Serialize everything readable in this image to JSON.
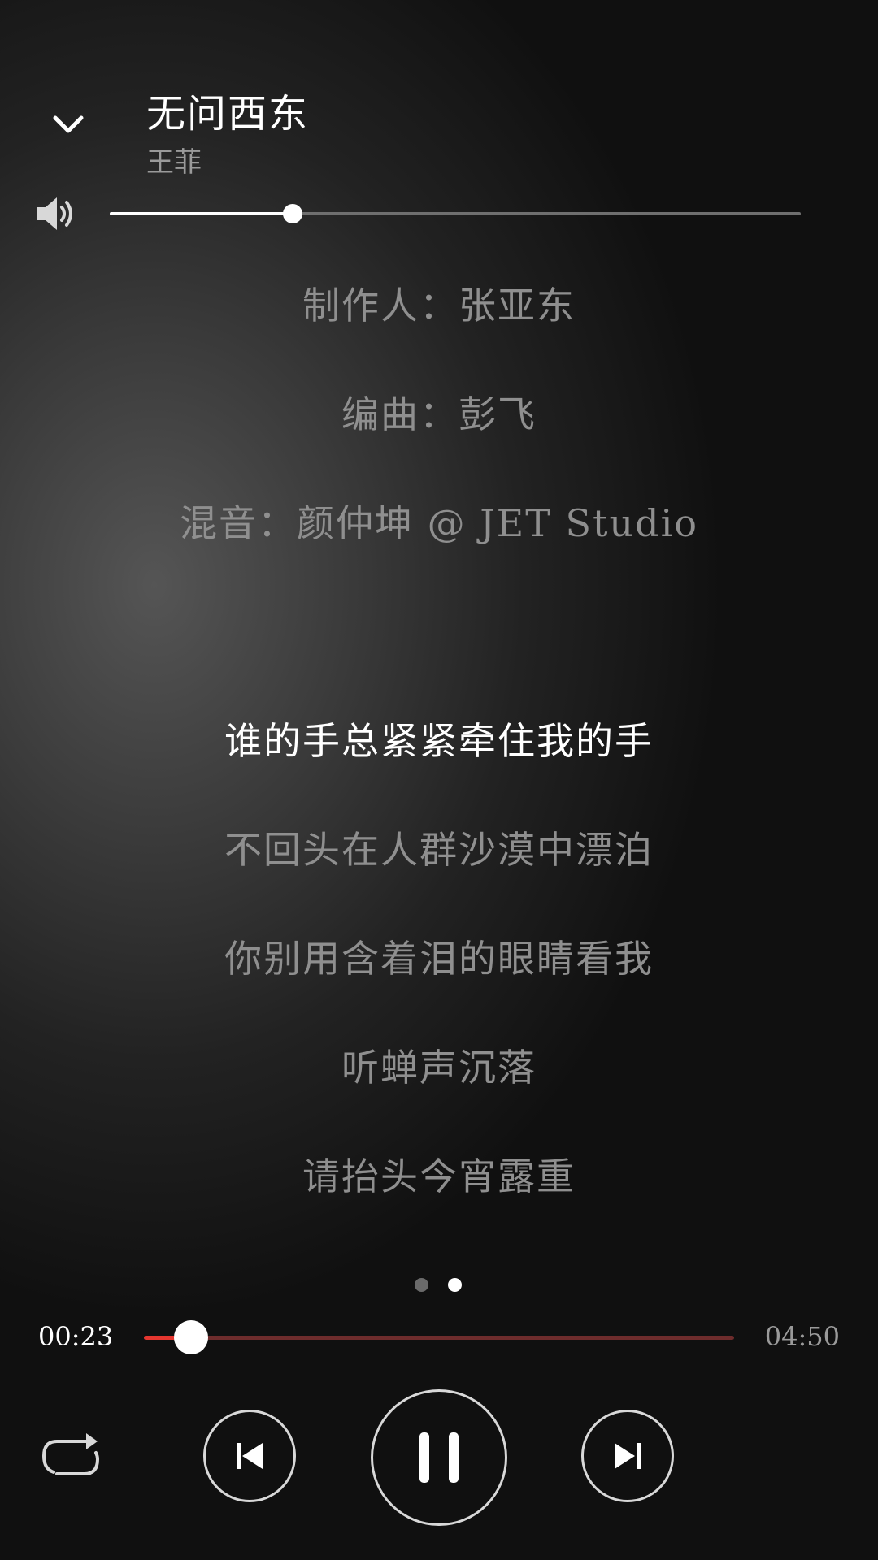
{
  "header": {
    "collapse_icon": "chevron-down-icon",
    "title": "无问西东",
    "artist": "王菲"
  },
  "volume": {
    "icon": "speaker-icon",
    "level": 0.265
  },
  "lyrics": {
    "lines": [
      {
        "text": "制作人：张亚东",
        "active": false
      },
      {
        "text": "编曲：彭飞",
        "active": false
      },
      {
        "text": "混音：颜仲坤 @ JET Studio",
        "active": false
      },
      {
        "text": "",
        "active": false
      },
      {
        "text": "谁的手总紧紧牵住我的手",
        "active": true
      },
      {
        "text": "不回头在人群沙漠中漂泊",
        "active": false
      },
      {
        "text": "你别用含着泪的眼睛看我",
        "active": false
      },
      {
        "text": "听蝉声沉落",
        "active": false
      },
      {
        "text": "请抬头今宵露重",
        "active": false
      }
    ]
  },
  "pager": {
    "count": 2,
    "active_index": 1
  },
  "playback": {
    "current_time": "00:23",
    "total_time": "04:50",
    "progress": 0.08
  },
  "controls": {
    "repeat_icon": "repeat-icon",
    "previous_icon": "skip-previous-icon",
    "play_pause_icon": "pause-icon",
    "next_icon": "skip-next-icon"
  },
  "colors": {
    "accent": "#e5362f",
    "progress_track": "#6e2c2c",
    "active_text": "#ffffff",
    "inactive_text": "#8f8f8f"
  }
}
